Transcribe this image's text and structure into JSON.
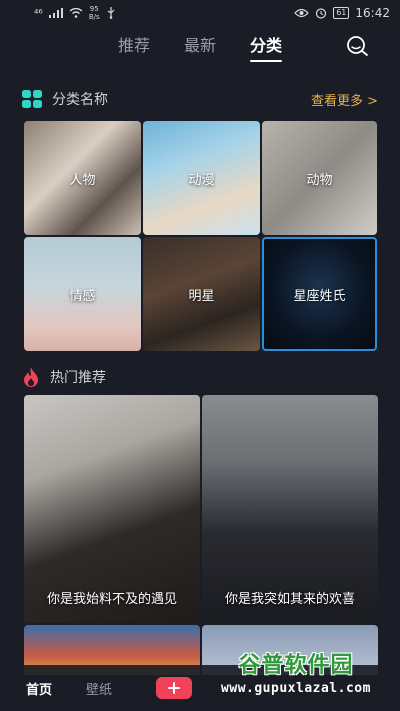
{
  "status_bar": {
    "signal": "⁴⁶",
    "net_speed_value": "95",
    "net_speed_unit": "B/s",
    "battery": "61",
    "time": "16:42"
  },
  "header": {
    "tabs": [
      {
        "label": "推荐"
      },
      {
        "label": "最新"
      },
      {
        "label": "分类"
      }
    ],
    "active_tab": "分类"
  },
  "category_section": {
    "title": "分类名称",
    "more": "查看更多 >",
    "items": [
      {
        "label": "人物"
      },
      {
        "label": "动漫"
      },
      {
        "label": "动物"
      },
      {
        "label": "情感"
      },
      {
        "label": "明星"
      },
      {
        "label": "星座姓氏"
      }
    ]
  },
  "hot_section": {
    "title": "热门推荐",
    "items": [
      {
        "caption": "你是我始料不及的遇见"
      },
      {
        "caption": "你是我突如其来的欢喜"
      }
    ]
  },
  "bottom_nav": {
    "items": [
      {
        "label": "首页"
      },
      {
        "label": "壁纸"
      }
    ]
  },
  "watermark": {
    "brand": "谷普软件园",
    "url": "www.gupuxlazal.com"
  },
  "colors": {
    "background": "#1b1d26",
    "accent_gold": "#e4b34d",
    "accent_red": "#f0435a",
    "grid_icon": "#2fd6c4"
  }
}
